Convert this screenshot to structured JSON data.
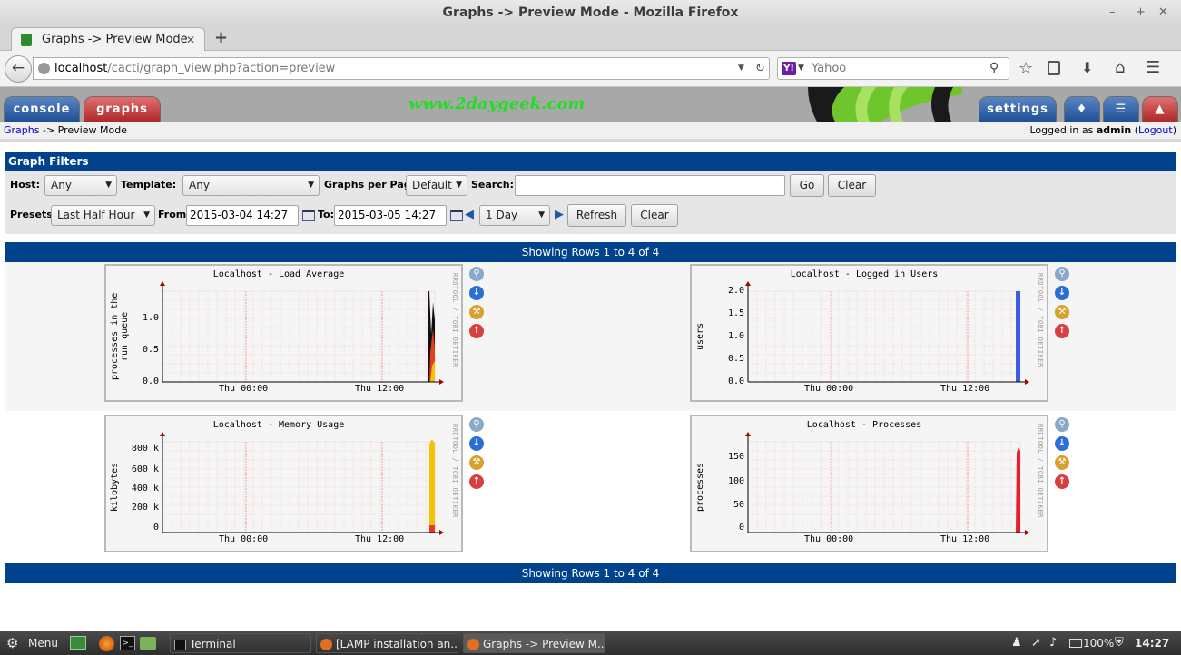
{
  "window": {
    "title": "Graphs -> Preview Mode - Mozilla Firefox",
    "min": "–",
    "max": "+",
    "close": "✕"
  },
  "tab": {
    "title": "Graphs -> Preview Mode",
    "close": "✕",
    "new": "+"
  },
  "nav": {
    "url_host": "localhost",
    "url_path": "/cacti/graph_view.php?action=preview",
    "search_engine": "Yahoo",
    "search_placeholder": "Yahoo"
  },
  "cacti": {
    "tabs": {
      "console": "console",
      "graphs": "graphs",
      "settings": "settings"
    },
    "watermark": "www.2daygeek.com",
    "breadcrumb": {
      "link": "Graphs",
      "sep": " -> ",
      "current": "Preview Mode"
    },
    "login": {
      "prefix": "Logged in as ",
      "user": "admin",
      "open": " (",
      "logout": "Logout",
      "close": ")"
    }
  },
  "filters": {
    "header": "Graph Filters",
    "host_label": "Host:",
    "host_value": "Any",
    "template_label": "Template:",
    "template_value": "Any",
    "gpp_label": "Graphs per Page:",
    "gpp_value": "Default",
    "search_label": "Search:",
    "search_value": "",
    "go": "Go",
    "clear1": "Clear",
    "presets_label": "Presets:",
    "presets_value": "Last Half Hour",
    "from_label": "From:",
    "from_value": "2015-03-04 14:27",
    "to_label": "To:",
    "to_value": "2015-03-05 14:27",
    "span_value": "1 Day",
    "refresh": "Refresh",
    "clear2": "Clear"
  },
  "rows_text": "Showing Rows 1 to 4 of 4",
  "graph_side": "RRDTOOL / TOBI OETIKER",
  "graphs": [
    {
      "title": "Localhost - Load Average",
      "ylabel": "processes in the run queue",
      "yticks": [
        "1.0",
        "0.5",
        "0.0"
      ],
      "xticks": [
        "Thu 00:00",
        "Thu 12:00"
      ]
    },
    {
      "title": "Localhost - Logged in Users",
      "ylabel": "users",
      "yticks": [
        "2.0",
        "1.5",
        "1.0",
        "0.5",
        "0.0"
      ],
      "xticks": [
        "Thu 00:00",
        "Thu 12:00"
      ]
    },
    {
      "title": "Localhost - Memory Usage",
      "ylabel": "kilobytes",
      "yticks": [
        "800 k",
        "600 k",
        "400 k",
        "200 k",
        "0"
      ],
      "xticks": [
        "Thu 00:00",
        "Thu 12:00"
      ]
    },
    {
      "title": "Localhost - Processes",
      "ylabel": "processes",
      "yticks": [
        "150",
        "100",
        "50",
        "0"
      ],
      "xticks": [
        "Thu 00:00",
        "Thu 12:00"
      ]
    }
  ],
  "taskbar": {
    "menu": "Menu",
    "tasks": [
      "Terminal",
      "[LAMP installation an...",
      "Graphs -> Preview M..."
    ],
    "battery": "100%",
    "clock": "14:27"
  }
}
